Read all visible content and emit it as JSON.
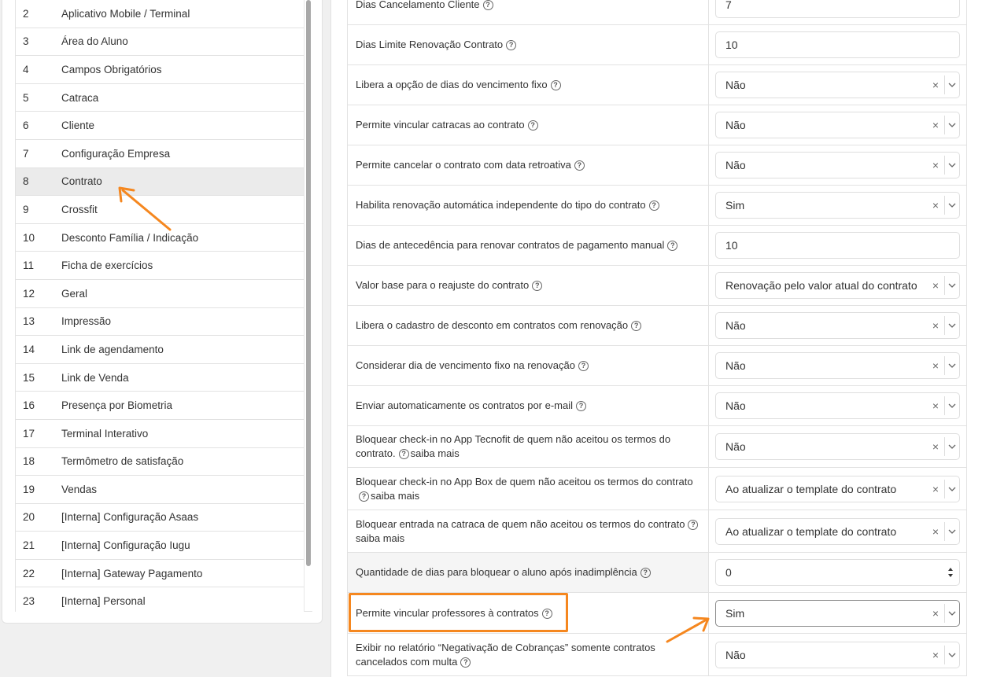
{
  "left_list": [
    {
      "num": "2",
      "label": "Aplicativo Mobile / Terminal"
    },
    {
      "num": "3",
      "label": "Área do Aluno"
    },
    {
      "num": "4",
      "label": "Campos Obrigatórios"
    },
    {
      "num": "5",
      "label": "Catraca"
    },
    {
      "num": "6",
      "label": "Cliente"
    },
    {
      "num": "7",
      "label": "Configuração Empresa"
    },
    {
      "num": "8",
      "label": "Contrato"
    },
    {
      "num": "9",
      "label": "Crossfit"
    },
    {
      "num": "10",
      "label": "Desconto Família / Indicação"
    },
    {
      "num": "11",
      "label": "Ficha de exercícios"
    },
    {
      "num": "12",
      "label": "Geral"
    },
    {
      "num": "13",
      "label": "Impressão"
    },
    {
      "num": "14",
      "label": "Link de agendamento"
    },
    {
      "num": "15",
      "label": "Link de Venda"
    },
    {
      "num": "16",
      "label": "Presença por Biometria"
    },
    {
      "num": "17",
      "label": "Terminal Interativo"
    },
    {
      "num": "18",
      "label": "Termômetro de satisfação"
    },
    {
      "num": "19",
      "label": "Vendas"
    },
    {
      "num": "20",
      "label": "[Interna] Configuração Asaas"
    },
    {
      "num": "21",
      "label": "[Interna] Configuração Iugu"
    },
    {
      "num": "22",
      "label": "[Interna] Gateway Pagamento"
    },
    {
      "num": "23",
      "label": "[Interna] Personal"
    }
  ],
  "selected_item": "Contrato",
  "settings": [
    {
      "label": "Dias Cancelamento Cliente",
      "help": "?",
      "control": "input",
      "value": "7"
    },
    {
      "label": "Dias Limite Renovação Contrato",
      "help": "?",
      "control": "input",
      "value": "10"
    },
    {
      "label": "Libera a opção de dias do vencimento fixo",
      "help": "?",
      "control": "select",
      "value": "Não"
    },
    {
      "label": "Permite vincular catracas ao contrato",
      "help": "?",
      "control": "select",
      "value": "Não"
    },
    {
      "label": "Permite cancelar o contrato com data retroativa",
      "help": "?",
      "control": "select",
      "value": "Não"
    },
    {
      "label": "Habilita renovação automática independente do tipo do contrato",
      "help": "?",
      "control": "select",
      "value": "Sim"
    },
    {
      "label": "Dias de antecedência para renovar contratos de pagamento manual",
      "help": "?",
      "control": "input",
      "value": "10"
    },
    {
      "label": "Valor base para o reajuste do contrato",
      "help": "?",
      "control": "select",
      "value": "Renovação pelo valor atual do contrato"
    },
    {
      "label": "Libera o cadastro de desconto em contratos com renovação",
      "help": "?",
      "control": "select",
      "value": "Não"
    },
    {
      "label": "Considerar dia de vencimento fixo na renovação",
      "help": "?",
      "control": "select",
      "value": "Não"
    },
    {
      "label": "Enviar automaticamente os contratos por e-mail",
      "help": "?",
      "control": "select",
      "value": "Não"
    },
    {
      "label": "Bloquear check-in no App Tecnofit de quem não aceitou os termos do contrato.",
      "help": "?",
      "suffix": "saiba mais",
      "control": "select",
      "value": "Não"
    },
    {
      "label": "Bloquear check-in no App Box de quem não aceitou os termos do contrato",
      "help": "?",
      "suffix": "saiba mais",
      "control": "select",
      "value": "Ao atualizar o template do contrato"
    },
    {
      "label": "Bloquear entrada na catraca de quem não aceitou os termos do contrato",
      "help": "?",
      "suffix": "saiba mais",
      "control": "select",
      "value": "Ao atualizar o template do contrato"
    },
    {
      "label": "Quantidade de dias para bloquear o aluno após inadimplência",
      "help": "?",
      "control": "number",
      "value": "0"
    },
    {
      "label": "Permite vincular professores à contratos",
      "help": "?",
      "control": "select",
      "value": "Sim"
    },
    {
      "label": "Exibir no relatório “Negativação de Cobranças” somente contratos cancelados com multa",
      "help": "?",
      "control": "select",
      "value": "Não"
    }
  ],
  "clear_symbol": "×",
  "colors": {
    "highlight": "#f5871f",
    "selected_row": "#ebebeb"
  }
}
